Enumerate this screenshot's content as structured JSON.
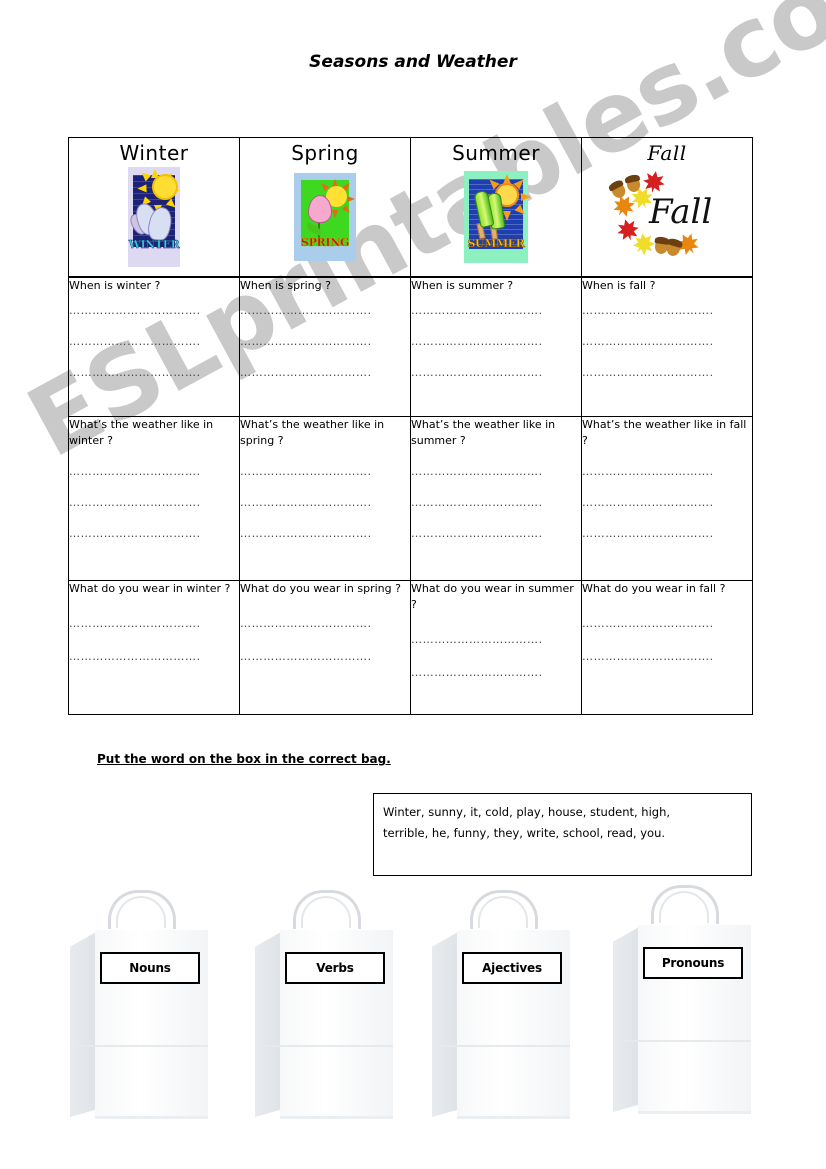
{
  "page": {
    "title": "Seasons and Weather",
    "watermark": "ESLprintables.com"
  },
  "table": {
    "columns": [
      {
        "season": "Winter",
        "art_word": "WINTER",
        "art_name": "winter-clipart",
        "questions": [
          {
            "text": "When is winter ?",
            "lines": 3
          },
          {
            "text": "What’s the weather like in winter ?",
            "lines": 3
          },
          {
            "text": "What do you wear in winter ?",
            "lines": 2
          }
        ]
      },
      {
        "season": "Spring",
        "art_word": "SPRING",
        "art_name": "spring-clipart",
        "questions": [
          {
            "text": "When is spring ?",
            "lines": 3
          },
          {
            "text": "What’s the weather like in spring ?",
            "lines": 3
          },
          {
            "text": "What do you wear in spring ?",
            "lines": 2
          }
        ]
      },
      {
        "season": "Summer",
        "art_word": "SUMMER",
        "art_name": "summer-clipart",
        "questions": [
          {
            "text": "When is summer ?",
            "lines": 3
          },
          {
            "text": "What’s the weather like in summer ?",
            "lines": 3
          },
          {
            "text": "What do you wear in summer ?",
            "lines": 2
          }
        ]
      },
      {
        "season": "Fall",
        "art_word": "Fall",
        "art_name": "fall-clipart",
        "questions": [
          {
            "text": "When is fall ?",
            "lines": 3
          },
          {
            "text": "What’s the weather like in fall ?",
            "lines": 3
          },
          {
            "text": "What do you wear in fall ?",
            "lines": 2
          }
        ]
      }
    ],
    "answer_line": "……………………………."
  },
  "exercise": {
    "instruction": "Put the word on the box in the correct bag.",
    "word_box": {
      "line1": "Winter, sunny, it, cold, play, house, student, high,",
      "line2": "terrible, he, funny, they, write, school, read, you."
    },
    "bags": [
      {
        "label": "Nouns"
      },
      {
        "label": "Verbs"
      },
      {
        "label": "Ajectives"
      },
      {
        "label": "Pronouns"
      }
    ]
  },
  "colors": {
    "winter_bg": "#ddd9f2",
    "winter_panel": "#1b2278",
    "winter_word": "#35d6c8",
    "spring_bg": "#a9cdea",
    "spring_field": "#3dd81f",
    "spring_word": "#e00000",
    "summer_bg": "#8cf0c0",
    "summer_panel": "#1f3fb0",
    "summer_word": "#ffbb00",
    "fall_red": "#d62020",
    "fall_orange": "#e8860f",
    "fall_yellow": "#f2dc2a",
    "watermark": "#c9c9c9",
    "border": "#000000"
  }
}
